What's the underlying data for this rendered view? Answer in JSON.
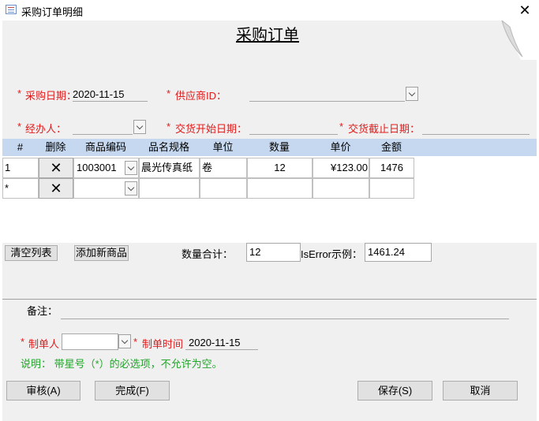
{
  "window": {
    "title": "采购订单明细",
    "close": "✕"
  },
  "form": {
    "heading": "采购订单",
    "star": "*",
    "purchase_date_label": "采购日期：",
    "purchase_date_value": "2020-11-15",
    "supplier_label": "供应商ID：",
    "supplier_value": "",
    "handler_label": "经办人：",
    "handler_value": "",
    "delivery_start_label": "交货开始日期：",
    "delivery_start_value": "",
    "delivery_end_label": "交货截止日期：",
    "delivery_end_value": ""
  },
  "grid": {
    "columns": [
      "#",
      "删除",
      "商品编码",
      "品名规格",
      "单位",
      "数量",
      "单价",
      "金额"
    ],
    "delete_glyph": "✕",
    "rows": [
      {
        "num": "1",
        "code": "1003001",
        "name": "晨光传真纸",
        "unit": "卷",
        "qty": "12",
        "price": "¥123.00",
        "amount": "1476"
      },
      {
        "num": "*",
        "code": "",
        "name": "",
        "unit": "",
        "qty": "",
        "price": "",
        "amount": ""
      }
    ]
  },
  "actions": {
    "clear_list": "清空列表",
    "add_product": "添加新商品",
    "qty_total_label": "数量合计：",
    "qty_total_value": "12",
    "iserror_label": "IsError示例：",
    "iserror_value": "1461.24"
  },
  "footer": {
    "remark_label": "备注：",
    "remark_value": "",
    "creator_label": "制单人",
    "creator_value": "",
    "created_time_label": "制单时间",
    "created_time_value": "2020-11-15",
    "note": "说明： 带星号（*）的必选项，不允许为空。"
  },
  "buttons": {
    "audit": "审核(A)",
    "finish": "完成(F)",
    "save": "保存(S)",
    "cancel": "取消"
  },
  "colors": {
    "required": "#e21b1b",
    "note": "#22a52a",
    "grid_header": "#c6d8ef",
    "form_bg": "#f0f0f0"
  }
}
